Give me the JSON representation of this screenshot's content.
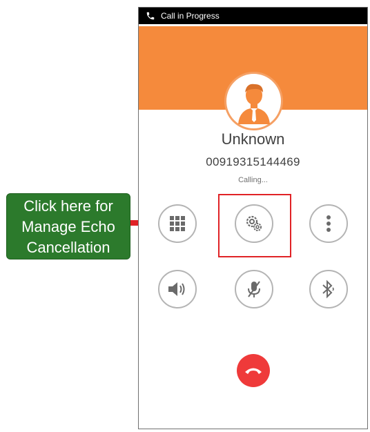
{
  "status_bar": {
    "text": "Call in Progress",
    "icon": "phone-icon"
  },
  "caller": {
    "name": "Unknown",
    "number": "00919315144469",
    "status": "Calling..."
  },
  "controls": {
    "row1": [
      "dialpad-icon",
      "settings-gears-icon",
      "more-vert-icon"
    ],
    "row2": [
      "speaker-icon",
      "mute-mic-icon",
      "bluetooth-icon"
    ],
    "end_call": "end-call-icon"
  },
  "callout": {
    "lines": [
      "Click here for",
      "Manage Echo",
      "Cancellation"
    ]
  },
  "colors": {
    "accent_orange": "#f58a3c",
    "highlight_red": "#e02226",
    "callout_green": "#2c7a2c",
    "end_call_red": "#ef3a3a"
  }
}
